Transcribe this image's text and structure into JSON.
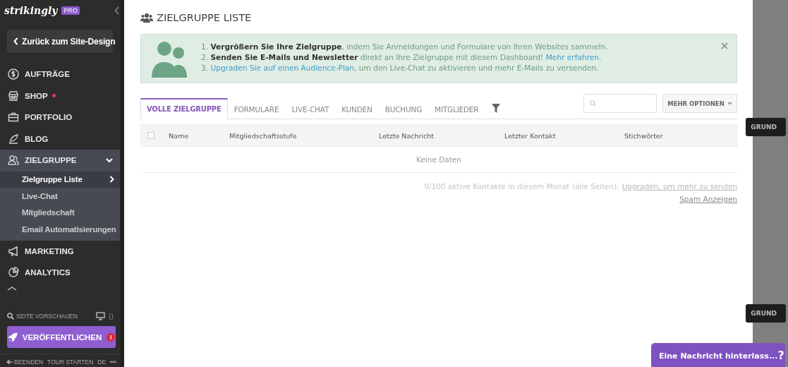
{
  "sidebar": {
    "logo": "strikingly",
    "plan_badge": "PRO",
    "back_button": "Zurück zum Site-Design",
    "items": [
      {
        "label": "AUFTRÄGE",
        "expanded": false,
        "dot": false
      },
      {
        "label": "SHOP",
        "expanded": false,
        "dot": true
      },
      {
        "label": "PORTFOLIO",
        "expanded": false,
        "dot": false
      },
      {
        "label": "BLOG",
        "expanded": false,
        "dot": false
      },
      {
        "label": "ZIELGRUPPE",
        "expanded": true,
        "dot": false,
        "children": [
          {
            "label": "Zielgruppe Liste",
            "selected": true
          },
          {
            "label": "Live-Chat",
            "selected": false
          },
          {
            "label": "Mitgliedschaft",
            "selected": false
          },
          {
            "label": "Email Automatisierungen",
            "selected": false
          }
        ]
      },
      {
        "label": "MARKETING",
        "expanded": false,
        "dot": false
      },
      {
        "label": "ANALYTICS",
        "expanded": false,
        "dot": false
      }
    ],
    "preview": "SEITE VORSCHAUEN",
    "publish_button": "VERÖFFENTLICHEN",
    "publish_alert": "!",
    "footer": [
      {
        "label": "BEENDEN",
        "kind": "exit"
      },
      {
        "label": "TOUR STARTEN",
        "kind": "plain"
      },
      {
        "label": "DE",
        "kind": "plain"
      },
      {
        "label": "•••",
        "kind": "plain"
      }
    ]
  },
  "page": {
    "title": "ZIELGRUPPE LISTE",
    "notice": {
      "lines": [
        [
          {
            "kind": "plain",
            "text": "1. "
          },
          {
            "kind": "bold",
            "text": "Vergrößern Sie Ihre Zielgruppe"
          },
          {
            "kind": "plain",
            "text": ", indem Sie Anmeldungen und Formulare von Ihren Websites sammeln."
          }
        ],
        [
          {
            "kind": "plain",
            "text": "2. "
          },
          {
            "kind": "bold",
            "text": "Senden Sie E-Mails und Newsletter"
          },
          {
            "kind": "plain",
            "text": " direkt an Ihre Zielgruppe mit diesem Dashboard! "
          },
          {
            "kind": "link",
            "text": "Mehr erfahren."
          }
        ],
        [
          {
            "kind": "plain",
            "text": "3. "
          },
          {
            "kind": "link",
            "text": "Upgraden Sie auf einen Audience-Plan"
          },
          {
            "kind": "plain",
            "text": ", um den Live-Chat zu aktivieren und mehr E-Mails zu versenden."
          }
        ]
      ]
    },
    "tabs": [
      {
        "label": "VOLLE ZIELGRUPPE",
        "selected": true
      },
      {
        "label": "FORMULARE",
        "selected": false
      },
      {
        "label": "LIVE-CHAT",
        "selected": false
      },
      {
        "label": "KUNDEN",
        "selected": false
      },
      {
        "label": "BUCHUNG",
        "selected": false
      },
      {
        "label": "MITGLIEDER",
        "selected": false
      }
    ],
    "more_button": "MEHR OPTIONEN",
    "table": {
      "select_all_checked": false,
      "columns": [
        "Name",
        "Mitgliedschaftsstufe",
        "Letzte Nachricht",
        "Letzter Kontakt",
        "Stichwörter"
      ],
      "empty_text": "Keine Daten"
    },
    "usage_text": "0/100 aktive Kontakte in diesem Monat (alle Seiten).",
    "upgrade_link": "Upgraden, um mehr zu senden",
    "spam_link": "Spam Anzeigen"
  },
  "background_buttons": [
    "GRUND",
    "GRUND"
  ],
  "chat_widget": {
    "label": "Eine Nachricht hinterlass...",
    "help": "?"
  }
}
